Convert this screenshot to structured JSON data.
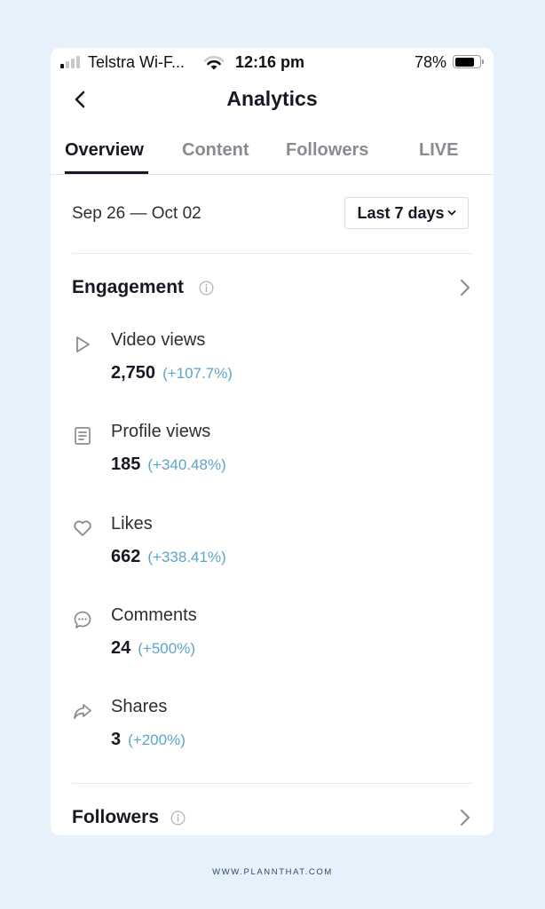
{
  "status_bar": {
    "carrier": "Telstra Wi-F...",
    "time": "12:16 pm",
    "battery_percent": "78%",
    "battery_level": 0.78,
    "signal_bars_active": 1,
    "signal_bars_total": 4
  },
  "nav": {
    "back_icon": "chevron-left-icon",
    "title": "Analytics"
  },
  "tabs": [
    {
      "label": "Overview",
      "active": true
    },
    {
      "label": "Content",
      "active": false
    },
    {
      "label": "Followers",
      "active": false
    },
    {
      "label": "LIVE",
      "active": false
    }
  ],
  "date_filter": {
    "range": "Sep 26 — Oct 02",
    "period": "Last 7 days"
  },
  "engagement": {
    "title": "Engagement",
    "metrics": [
      {
        "icon": "play-icon",
        "label": "Video views",
        "value": "2,750",
        "change": "(+107.7%)"
      },
      {
        "icon": "profile-doc-icon",
        "label": "Profile views",
        "value": "185",
        "change": "(+340.48%)"
      },
      {
        "icon": "heart-icon",
        "label": "Likes",
        "value": "662",
        "change": "(+338.41%)"
      },
      {
        "icon": "comment-icon",
        "label": "Comments",
        "value": "24",
        "change": "(+500%)"
      },
      {
        "icon": "share-icon",
        "label": "Shares",
        "value": "3",
        "change": "(+200%)"
      }
    ]
  },
  "followers_section": {
    "title": "Followers"
  },
  "colors": {
    "background": "#e6f1fc",
    "change_positive": "#5aa6c7",
    "text_primary": "#161823",
    "text_secondary": "#8a8b91"
  },
  "watermark": "WWW.PLANNTHAT.COM"
}
